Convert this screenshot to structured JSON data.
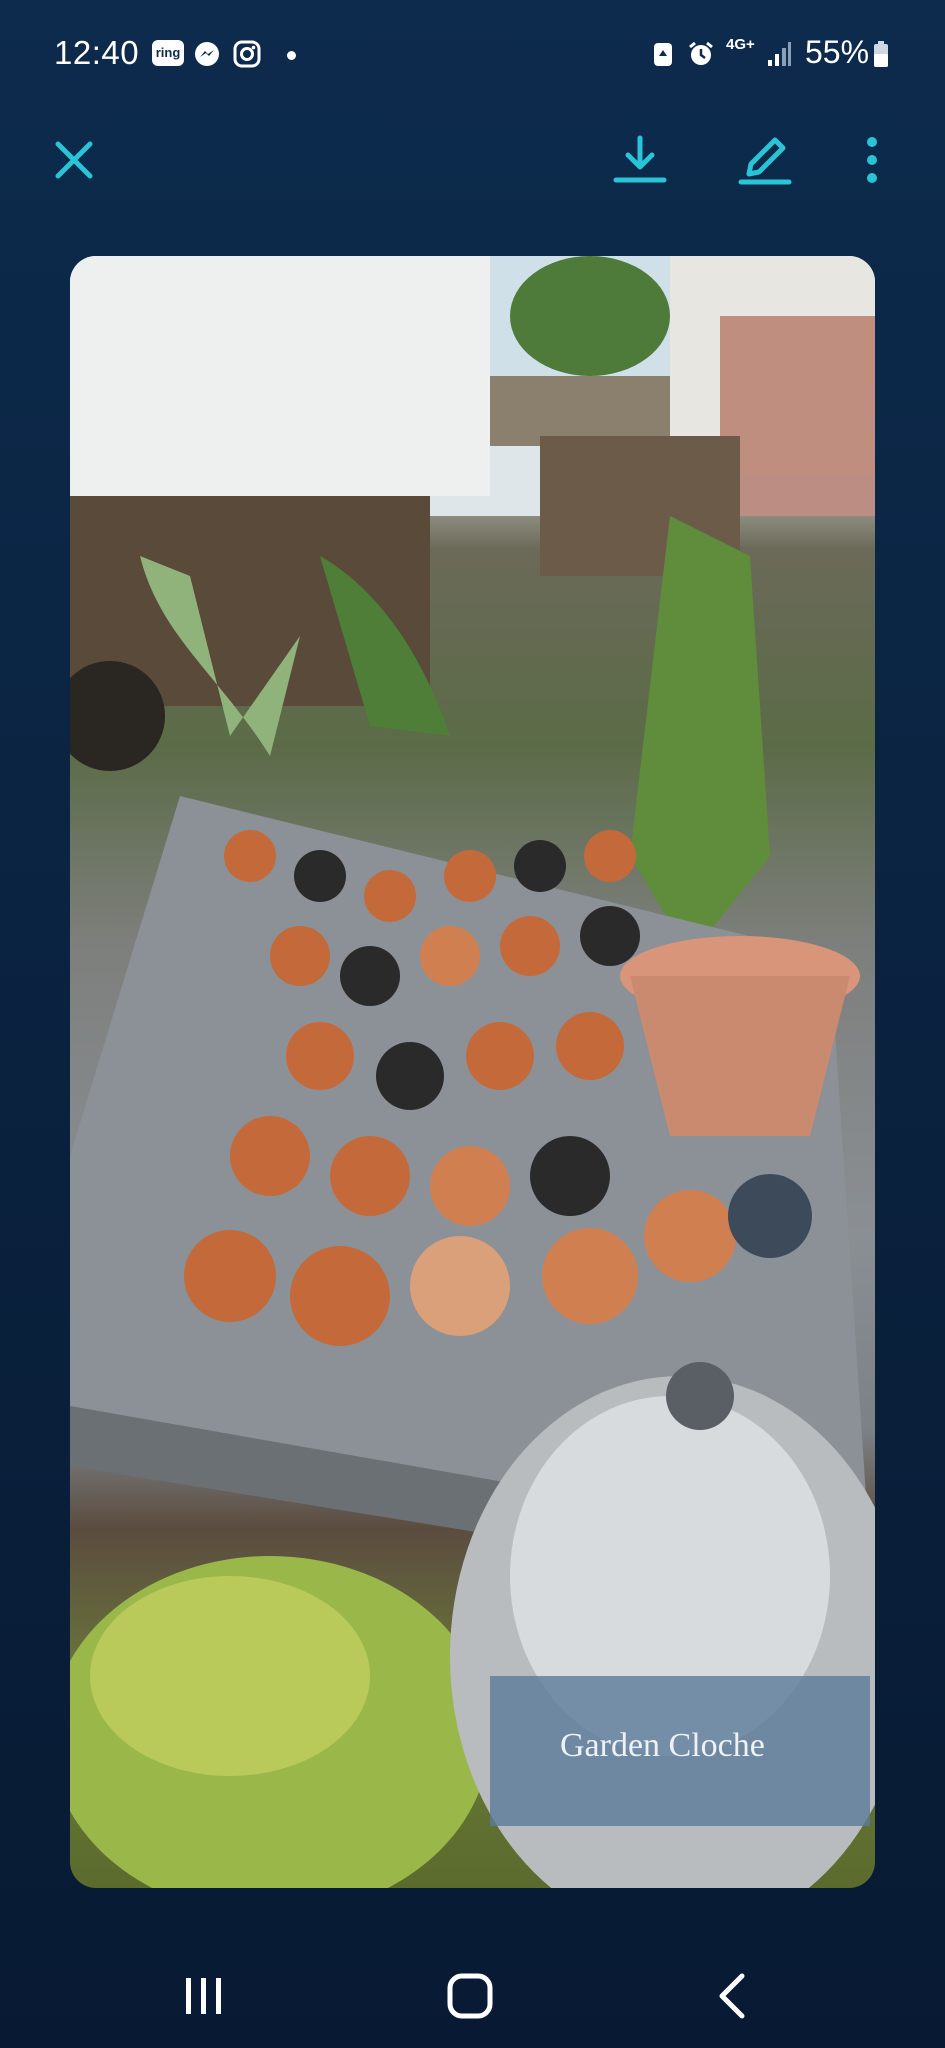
{
  "status_bar": {
    "time": "12:40",
    "notification_icons": [
      "ring-icon",
      "messenger-icon",
      "instagram-icon",
      "dot-icon"
    ],
    "ring_label": "ring",
    "system_icons": [
      "recycle-icon",
      "alarm-icon",
      "network-4g-icon",
      "signal-icon",
      "battery-icon"
    ],
    "network_label": "4G+",
    "battery_percent": "55%"
  },
  "toolbar": {
    "close_icon": "close-icon",
    "download_icon": "download-icon",
    "edit_icon": "edit-pencil-icon",
    "more_icon": "more-vertical-icon",
    "accent_color": "#29c4d6"
  },
  "photo": {
    "embedded_text": "Garden Cloche"
  },
  "nav_bar": {
    "icons": [
      "recent-apps-icon",
      "home-icon",
      "back-icon"
    ]
  }
}
